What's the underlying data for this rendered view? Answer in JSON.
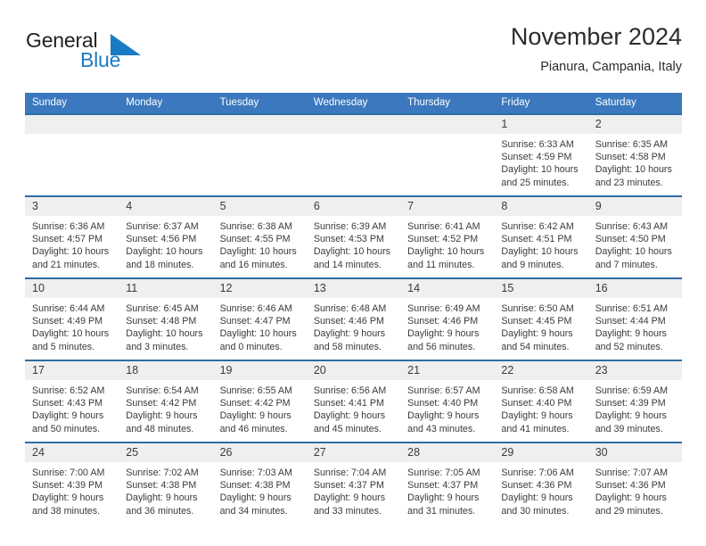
{
  "brand": {
    "word1": "General",
    "word2": "Blue",
    "mark_color": "#1a7bc4",
    "text_color": "#231f20"
  },
  "header": {
    "title": "November 2024",
    "subtitle": "Pianura, Campania, Italy"
  },
  "theme": {
    "header_blue": "#3b78bd",
    "row_border_blue": "#2e6da4",
    "daynum_background": "#efefef",
    "text": "#3a3a3a"
  },
  "weekdays": [
    "Sunday",
    "Monday",
    "Tuesday",
    "Wednesday",
    "Thursday",
    "Friday",
    "Saturday"
  ],
  "labels": {
    "sunrise": "Sunrise:",
    "sunset": "Sunset:",
    "daylight": "Daylight:"
  },
  "weeks": [
    [
      {
        "day": "",
        "empty": true
      },
      {
        "day": "",
        "empty": true
      },
      {
        "day": "",
        "empty": true
      },
      {
        "day": "",
        "empty": true
      },
      {
        "day": "",
        "empty": true
      },
      {
        "day": "1",
        "sunrise": "Sunrise: 6:33 AM",
        "sunset": "Sunset: 4:59 PM",
        "daylight1": "Daylight: 10 hours",
        "daylight2": "and 25 minutes."
      },
      {
        "day": "2",
        "sunrise": "Sunrise: 6:35 AM",
        "sunset": "Sunset: 4:58 PM",
        "daylight1": "Daylight: 10 hours",
        "daylight2": "and 23 minutes."
      }
    ],
    [
      {
        "day": "3",
        "sunrise": "Sunrise: 6:36 AM",
        "sunset": "Sunset: 4:57 PM",
        "daylight1": "Daylight: 10 hours",
        "daylight2": "and 21 minutes."
      },
      {
        "day": "4",
        "sunrise": "Sunrise: 6:37 AM",
        "sunset": "Sunset: 4:56 PM",
        "daylight1": "Daylight: 10 hours",
        "daylight2": "and 18 minutes."
      },
      {
        "day": "5",
        "sunrise": "Sunrise: 6:38 AM",
        "sunset": "Sunset: 4:55 PM",
        "daylight1": "Daylight: 10 hours",
        "daylight2": "and 16 minutes."
      },
      {
        "day": "6",
        "sunrise": "Sunrise: 6:39 AM",
        "sunset": "Sunset: 4:53 PM",
        "daylight1": "Daylight: 10 hours",
        "daylight2": "and 14 minutes."
      },
      {
        "day": "7",
        "sunrise": "Sunrise: 6:41 AM",
        "sunset": "Sunset: 4:52 PM",
        "daylight1": "Daylight: 10 hours",
        "daylight2": "and 11 minutes."
      },
      {
        "day": "8",
        "sunrise": "Sunrise: 6:42 AM",
        "sunset": "Sunset: 4:51 PM",
        "daylight1": "Daylight: 10 hours",
        "daylight2": "and 9 minutes."
      },
      {
        "day": "9",
        "sunrise": "Sunrise: 6:43 AM",
        "sunset": "Sunset: 4:50 PM",
        "daylight1": "Daylight: 10 hours",
        "daylight2": "and 7 minutes."
      }
    ],
    [
      {
        "day": "10",
        "sunrise": "Sunrise: 6:44 AM",
        "sunset": "Sunset: 4:49 PM",
        "daylight1": "Daylight: 10 hours",
        "daylight2": "and 5 minutes."
      },
      {
        "day": "11",
        "sunrise": "Sunrise: 6:45 AM",
        "sunset": "Sunset: 4:48 PM",
        "daylight1": "Daylight: 10 hours",
        "daylight2": "and 3 minutes."
      },
      {
        "day": "12",
        "sunrise": "Sunrise: 6:46 AM",
        "sunset": "Sunset: 4:47 PM",
        "daylight1": "Daylight: 10 hours",
        "daylight2": "and 0 minutes."
      },
      {
        "day": "13",
        "sunrise": "Sunrise: 6:48 AM",
        "sunset": "Sunset: 4:46 PM",
        "daylight1": "Daylight: 9 hours",
        "daylight2": "and 58 minutes."
      },
      {
        "day": "14",
        "sunrise": "Sunrise: 6:49 AM",
        "sunset": "Sunset: 4:46 PM",
        "daylight1": "Daylight: 9 hours",
        "daylight2": "and 56 minutes."
      },
      {
        "day": "15",
        "sunrise": "Sunrise: 6:50 AM",
        "sunset": "Sunset: 4:45 PM",
        "daylight1": "Daylight: 9 hours",
        "daylight2": "and 54 minutes."
      },
      {
        "day": "16",
        "sunrise": "Sunrise: 6:51 AM",
        "sunset": "Sunset: 4:44 PM",
        "daylight1": "Daylight: 9 hours",
        "daylight2": "and 52 minutes."
      }
    ],
    [
      {
        "day": "17",
        "sunrise": "Sunrise: 6:52 AM",
        "sunset": "Sunset: 4:43 PM",
        "daylight1": "Daylight: 9 hours",
        "daylight2": "and 50 minutes."
      },
      {
        "day": "18",
        "sunrise": "Sunrise: 6:54 AM",
        "sunset": "Sunset: 4:42 PM",
        "daylight1": "Daylight: 9 hours",
        "daylight2": "and 48 minutes."
      },
      {
        "day": "19",
        "sunrise": "Sunrise: 6:55 AM",
        "sunset": "Sunset: 4:42 PM",
        "daylight1": "Daylight: 9 hours",
        "daylight2": "and 46 minutes."
      },
      {
        "day": "20",
        "sunrise": "Sunrise: 6:56 AM",
        "sunset": "Sunset: 4:41 PM",
        "daylight1": "Daylight: 9 hours",
        "daylight2": "and 45 minutes."
      },
      {
        "day": "21",
        "sunrise": "Sunrise: 6:57 AM",
        "sunset": "Sunset: 4:40 PM",
        "daylight1": "Daylight: 9 hours",
        "daylight2": "and 43 minutes."
      },
      {
        "day": "22",
        "sunrise": "Sunrise: 6:58 AM",
        "sunset": "Sunset: 4:40 PM",
        "daylight1": "Daylight: 9 hours",
        "daylight2": "and 41 minutes."
      },
      {
        "day": "23",
        "sunrise": "Sunrise: 6:59 AM",
        "sunset": "Sunset: 4:39 PM",
        "daylight1": "Daylight: 9 hours",
        "daylight2": "and 39 minutes."
      }
    ],
    [
      {
        "day": "24",
        "sunrise": "Sunrise: 7:00 AM",
        "sunset": "Sunset: 4:39 PM",
        "daylight1": "Daylight: 9 hours",
        "daylight2": "and 38 minutes."
      },
      {
        "day": "25",
        "sunrise": "Sunrise: 7:02 AM",
        "sunset": "Sunset: 4:38 PM",
        "daylight1": "Daylight: 9 hours",
        "daylight2": "and 36 minutes."
      },
      {
        "day": "26",
        "sunrise": "Sunrise: 7:03 AM",
        "sunset": "Sunset: 4:38 PM",
        "daylight1": "Daylight: 9 hours",
        "daylight2": "and 34 minutes."
      },
      {
        "day": "27",
        "sunrise": "Sunrise: 7:04 AM",
        "sunset": "Sunset: 4:37 PM",
        "daylight1": "Daylight: 9 hours",
        "daylight2": "and 33 minutes."
      },
      {
        "day": "28",
        "sunrise": "Sunrise: 7:05 AM",
        "sunset": "Sunset: 4:37 PM",
        "daylight1": "Daylight: 9 hours",
        "daylight2": "and 31 minutes."
      },
      {
        "day": "29",
        "sunrise": "Sunrise: 7:06 AM",
        "sunset": "Sunset: 4:36 PM",
        "daylight1": "Daylight: 9 hours",
        "daylight2": "and 30 minutes."
      },
      {
        "day": "30",
        "sunrise": "Sunrise: 7:07 AM",
        "sunset": "Sunset: 4:36 PM",
        "daylight1": "Daylight: 9 hours",
        "daylight2": "and 29 minutes."
      }
    ]
  ]
}
